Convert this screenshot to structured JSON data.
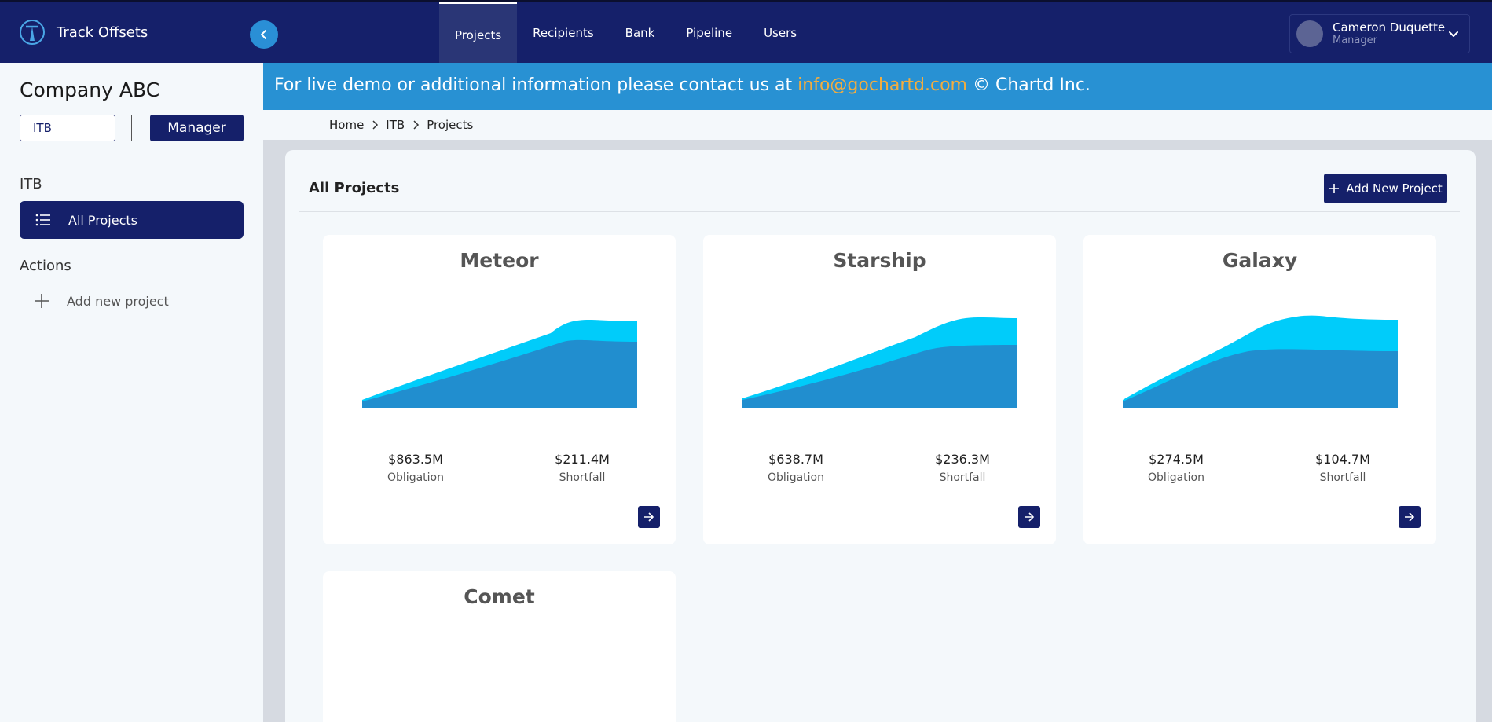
{
  "app": {
    "name": "Track Offsets"
  },
  "nav": {
    "items": [
      {
        "label": "Projects",
        "active": true
      },
      {
        "label": "Recipients"
      },
      {
        "label": "Bank"
      },
      {
        "label": "Pipeline"
      },
      {
        "label": "Users"
      }
    ]
  },
  "user": {
    "name": "Cameron Duquette",
    "role": "Manager"
  },
  "sidebar": {
    "company": "Company ABC",
    "program_select": "ITB",
    "role_button": "Manager",
    "section_label": "ITB",
    "active_item": "All Projects",
    "actions_label": "Actions",
    "action_item": "Add new project"
  },
  "banner": {
    "prefix": "For live demo or additional information please contact us at",
    "email": "info@gochartd.com",
    "suffix": "© Chartd Inc."
  },
  "breadcrumb": {
    "items": [
      "Home",
      "ITB",
      "Projects"
    ]
  },
  "main": {
    "title": "All Projects",
    "add_button": "Add New Project"
  },
  "cards": [
    {
      "name": "Meteor",
      "obligation": "$863.5M",
      "obligation_label": "Obligation",
      "shortfall": "$211.4M",
      "shortfall_label": "Shortfall"
    },
    {
      "name": "Starship",
      "obligation": "$638.7M",
      "obligation_label": "Obligation",
      "shortfall": "$236.3M",
      "shortfall_label": "Shortfall"
    },
    {
      "name": "Galaxy",
      "obligation": "$274.5M",
      "obligation_label": "Obligation",
      "shortfall": "$104.7M",
      "shortfall_label": "Shortfall"
    },
    {
      "name": "Comet"
    }
  ],
  "colors": {
    "navy": "#15206a",
    "banner_blue": "#2891d3",
    "email_orange": "#f3ad3e",
    "chart_outer": "#00ccfa",
    "chart_inner": "#218ecf"
  },
  "icons": [
    "logo-icon",
    "chevron-left-icon",
    "chevron-down-icon",
    "list-icon",
    "plus-icon",
    "chevron-right-icon",
    "arrow-right-icon"
  ]
}
